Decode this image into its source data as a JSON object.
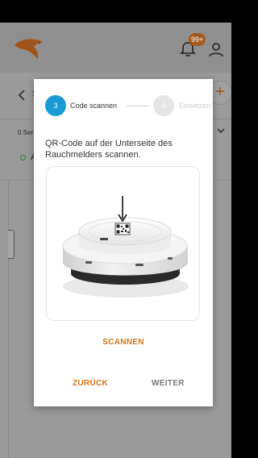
{
  "header": {
    "notification_badge": "99+",
    "bell_icon": "bell-icon",
    "account_icon": "person-icon",
    "logo_icon": "bird-logo-icon",
    "accent_color": "#a0541a"
  },
  "nav": {
    "back_icon": "chevron-left-icon",
    "partial_title": "S",
    "add_icon": "plus-icon"
  },
  "background_list": {
    "count_label": "0 Ser",
    "item_letter": "A",
    "status_color": "#2e7d32",
    "expand_icon": "chevron-down-icon"
  },
  "dialog": {
    "steps": [
      {
        "number": "3",
        "label": "Code scannen",
        "state": "active"
      },
      {
        "number": "4",
        "label": "Einsetzen",
        "state": "inactive"
      }
    ],
    "instruction": "QR-Code auf der Unterseite des Rauchmelders scannen.",
    "image_alt": "smoke-detector-qr-code-image",
    "scan_label": "SCANNEN",
    "back_label": "ZURÜCK",
    "next_label": "WEITER",
    "primary_color": "#1a9ad6",
    "action_color": "#d4761a"
  }
}
